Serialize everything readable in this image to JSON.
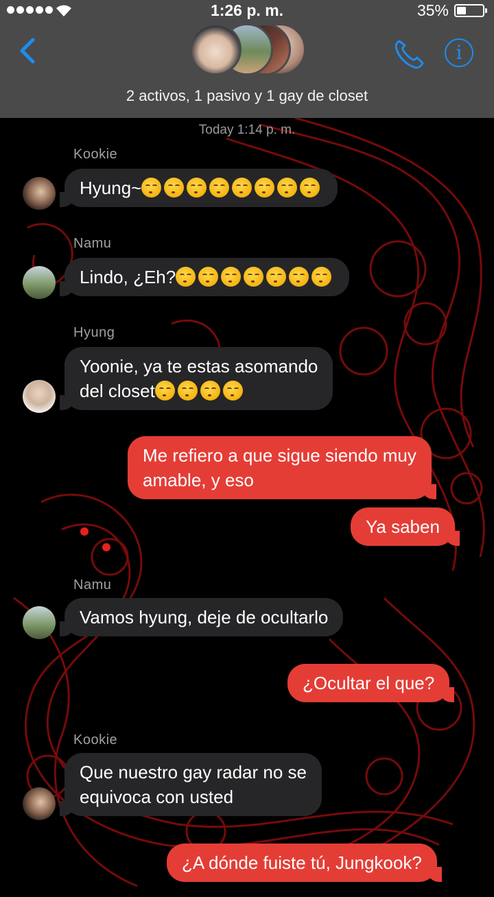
{
  "status_bar": {
    "time": "1:26 p. m.",
    "battery_percent": "35%",
    "battery_level": 0.35
  },
  "header": {
    "title": "2 activos, 1 pasivo y 1 gay de closet"
  },
  "icons": {
    "back": "chevron-left-icon",
    "call": "phone-icon",
    "info": "info-icon",
    "info_glyph": "i"
  },
  "colors": {
    "accent_blue": "#1d8cf0",
    "outgoing": "#e43d36",
    "incoming": "#262628",
    "header_bg": "#4a4a4a"
  },
  "chat": {
    "timestamp": "Today 1:14 p. m.",
    "messages": [
      {
        "sender": "Kookie",
        "text": "Hyung~",
        "emoji_count": 8
      },
      {
        "sender": "Namu",
        "text": "Lindo, ¿Eh?",
        "emoji_count": 7
      },
      {
        "sender": "Hyung",
        "line1": "Yoonie, ya te estas asomando",
        "line2": "del closet",
        "emoji_count": 4
      },
      {
        "line1": "Me refiero a que sigue siendo muy",
        "line2": "amable, y eso"
      },
      {
        "text": "Ya saben"
      },
      {
        "sender": "Namu",
        "text": "Vamos hyung, deje de ocultarlo"
      },
      {
        "text": "¿Ocultar el que?"
      },
      {
        "sender": "Kookie",
        "line1": "Que nuestro gay radar no se",
        "line2": "equivoca con usted"
      },
      {
        "text": "¿A dónde fuiste tú, Jungkook?"
      }
    ]
  }
}
